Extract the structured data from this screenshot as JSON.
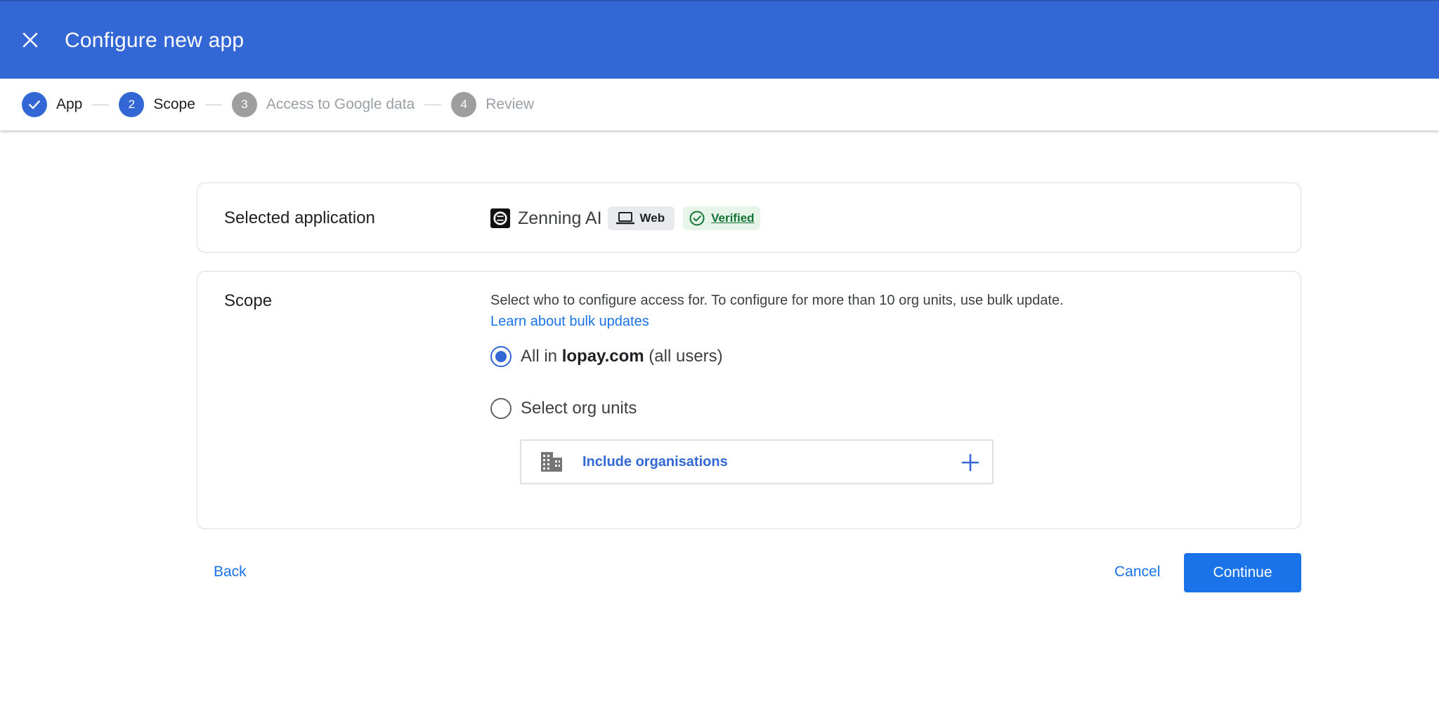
{
  "header": {
    "title": "Configure new app",
    "close_icon": "close-icon"
  },
  "stepper": {
    "steps": [
      {
        "number": "",
        "label": "App",
        "state": "done"
      },
      {
        "number": "2",
        "label": "Scope",
        "state": "active"
      },
      {
        "number": "3",
        "label": "Access to Google data",
        "state": "pending"
      },
      {
        "number": "4",
        "label": "Review",
        "state": "pending"
      }
    ]
  },
  "selected_app": {
    "heading": "Selected application",
    "app_name": "Zenning AI",
    "platform_chip": "Web",
    "verified_chip": "Verified"
  },
  "scope": {
    "heading": "Scope",
    "description": "Select who to configure access for. To configure for more than 10 org units, use bulk update.",
    "link": "Learn about bulk updates",
    "option_all": {
      "prefix": "All in",
      "domain": "lopay.com",
      "suffix": "(all users)",
      "checked": true
    },
    "option_org_units": {
      "label": "Select org units",
      "checked": false
    },
    "include_label": "Include organisations"
  },
  "actions": {
    "back": "Back",
    "cancel": "Cancel",
    "continue": "Continue"
  },
  "colors": {
    "header_blue": "#3367d6",
    "primary_blue": "#1a73e8",
    "verified_green": "#137333"
  }
}
